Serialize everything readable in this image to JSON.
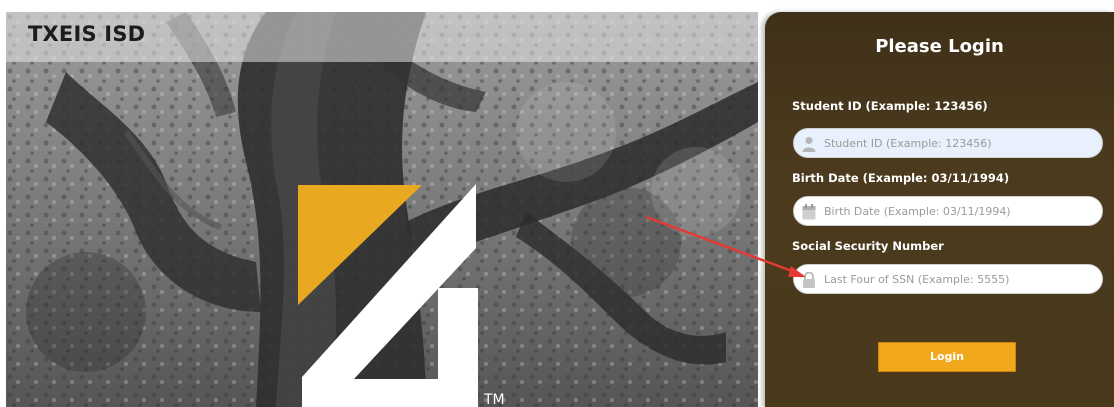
{
  "header": {
    "title": "TXEIS ISD"
  },
  "logo": {
    "trademark": "TM",
    "accent_color": "#e8a820"
  },
  "login": {
    "title": "Please Login",
    "student_id": {
      "label": "Student ID (Example: 123456)",
      "placeholder": "Student ID (Example: 123456)",
      "value": "",
      "icon": "user-icon"
    },
    "birth_date": {
      "label": "Birth Date (Example: 03/11/1994)",
      "placeholder": "Birth Date (Example: 03/11/1994)",
      "value": "",
      "icon": "calendar-icon"
    },
    "ssn": {
      "label": "Social Security Number",
      "placeholder": "Last Four of SSN (Example: 5555)",
      "value": "",
      "icon": "lock-icon"
    },
    "submit_label": "Login",
    "button_color": "#f2a81d",
    "panel_color": "#4a391b"
  },
  "annotation": {
    "arrow_color": "#e53935"
  }
}
